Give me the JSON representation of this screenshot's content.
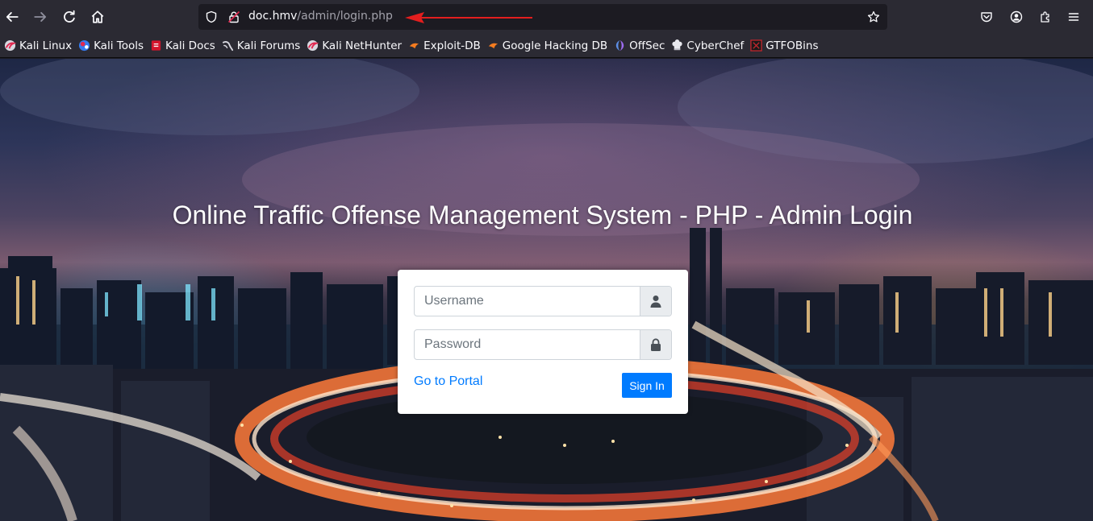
{
  "browser": {
    "url_host": "doc.hmv",
    "url_path": "/admin/login.php",
    "bookmarks": [
      {
        "label": "Kali Linux",
        "icon": "kali-icon"
      },
      {
        "label": "Kali Tools",
        "icon": "kali-tools-icon"
      },
      {
        "label": "Kali Docs",
        "icon": "kali-docs-icon"
      },
      {
        "label": "Kali Forums",
        "icon": "kali-forums-icon"
      },
      {
        "label": "Kali NetHunter",
        "icon": "kali-nethunter-icon"
      },
      {
        "label": "Exploit-DB",
        "icon": "exploit-db-icon"
      },
      {
        "label": "Google Hacking DB",
        "icon": "ghdb-icon"
      },
      {
        "label": "OffSec",
        "icon": "offsec-icon"
      },
      {
        "label": "CyberChef",
        "icon": "cyberchef-icon"
      },
      {
        "label": "GTFOBins",
        "icon": "gtfobins-icon"
      }
    ],
    "colors": {
      "toolbar": "#2b2a33",
      "urlbar": "#1c1b22",
      "annotation_arrow": "#e31e1e"
    }
  },
  "login": {
    "title": "Online Traffic Offense Management System - PHP - Admin Login",
    "username_placeholder": "Username",
    "password_placeholder": "Password",
    "portal_link": "Go to Portal",
    "signin_label": "Sign In",
    "colors": {
      "primary": "#007bff",
      "card_bg": "#ffffff"
    }
  }
}
